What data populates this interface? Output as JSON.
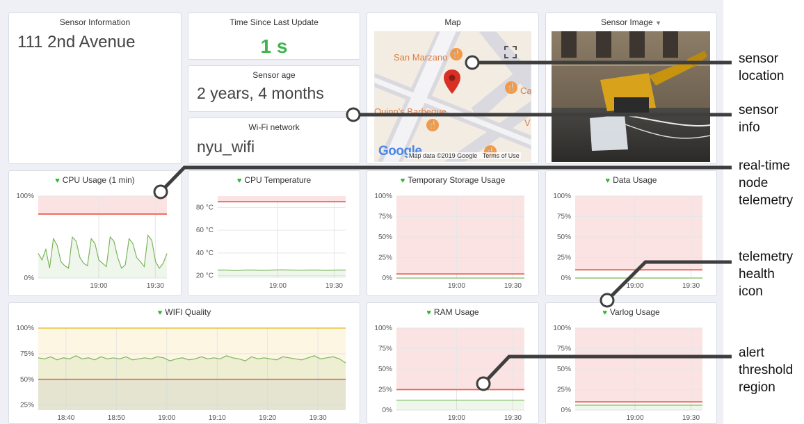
{
  "colors": {
    "heart": "#2eb82e",
    "threshold": "#e8675a",
    "threshold_fill": "#fbe3e3",
    "warning": "#e9c13a",
    "series": "#7cb45c",
    "value_green": "#3ab54a"
  },
  "panels": {
    "sensor_info": {
      "title": "Sensor Information",
      "value": "111 2nd Avenue"
    },
    "time_since": {
      "title": "Time Since Last Update",
      "value": "1 s"
    },
    "sensor_age": {
      "title": "Sensor age",
      "value": "2 years, 4 months"
    },
    "wifi_network": {
      "title": "Wi-Fi network",
      "value": "nyu_wifi"
    },
    "map": {
      "title": "Map",
      "labels": [
        "San Marzano",
        "Quinn's Barbeque",
        "Ca",
        "V"
      ],
      "attribution": "Map data ©2019 Google",
      "terms": "Terms of Use",
      "logo": "Google"
    },
    "sensor_image": {
      "title": "Sensor Image",
      "menu_icon": "caret-down-icon"
    }
  },
  "annotations": {
    "sensor_location": [
      "sensor",
      "location"
    ],
    "sensor_info": [
      "sensor",
      "info"
    ],
    "realtime": [
      "real-time",
      "node",
      "telemetry"
    ],
    "health": [
      "telemetry",
      "health",
      "icon"
    ],
    "alert": [
      "alert",
      "threshold",
      "region"
    ]
  },
  "chart_data": [
    {
      "id": "cpu_usage",
      "type": "line",
      "title": "CPU Usage (1 min)",
      "x_ticks": [
        "19:00",
        "19:30"
      ],
      "y_ticks": [
        "0%",
        "100%"
      ],
      "ylim": [
        0,
        100
      ],
      "threshold": 78,
      "series": [
        {
          "values": [
            30,
            22,
            35,
            12,
            48,
            40,
            20,
            15,
            12,
            50,
            45,
            25,
            18,
            15,
            48,
            42,
            22,
            18,
            14,
            50,
            45,
            25,
            12,
            16,
            48,
            42,
            25,
            20,
            14,
            52,
            46,
            20,
            12,
            18,
            30
          ]
        }
      ]
    },
    {
      "id": "cpu_temp",
      "type": "line",
      "title": "CPU Temperature",
      "x_ticks": [
        "19:00",
        "19:30"
      ],
      "y_ticks": [
        "20 °C",
        "40 °C",
        "60 °C",
        "80 °C"
      ],
      "ylim": [
        18,
        90
      ],
      "threshold": 85,
      "series": [
        {
          "values": [
            25,
            25,
            24.5,
            25,
            25,
            24.8,
            25,
            25.2,
            25,
            24.9,
            25,
            25,
            24.8,
            25,
            25
          ]
        }
      ]
    },
    {
      "id": "temp_storage",
      "type": "line",
      "title": "Temporary Storage Usage",
      "x_ticks": [
        "19:00",
        "19:30"
      ],
      "y_ticks": [
        "0%",
        "25%",
        "50%",
        "75%",
        "100%"
      ],
      "ylim": [
        0,
        100
      ],
      "threshold": 5,
      "series": [
        {
          "values": [
            0,
            0,
            0,
            0,
            0,
            0
          ]
        }
      ]
    },
    {
      "id": "data_usage",
      "type": "line",
      "title": "Data Usage",
      "x_ticks": [
        "19:00",
        "19:30"
      ],
      "y_ticks": [
        "0%",
        "25%",
        "50%",
        "75%",
        "100%"
      ],
      "ylim": [
        0,
        100
      ],
      "threshold": 10,
      "series": [
        {
          "values": [
            0,
            0,
            0,
            0,
            0,
            0
          ]
        }
      ]
    },
    {
      "id": "wifi_quality",
      "type": "line",
      "title": "WIFI Quality",
      "x_ticks": [
        "18:40",
        "18:50",
        "19:00",
        "19:10",
        "19:20",
        "19:30"
      ],
      "y_ticks": [
        "25%",
        "50%",
        "75%",
        "100%"
      ],
      "ylim": [
        20,
        100
      ],
      "threshold": 50,
      "warning": 100,
      "series": [
        {
          "values": [
            71,
            70,
            72,
            69,
            71,
            70,
            73,
            70,
            71,
            69,
            72,
            70,
            71,
            70,
            72,
            69,
            70,
            71,
            70,
            72,
            71,
            68,
            70,
            71,
            69,
            70,
            72,
            70,
            71,
            70,
            73,
            71,
            70,
            68,
            72,
            70,
            71,
            70,
            69,
            72,
            71,
            70,
            69,
            71,
            73,
            70,
            71,
            72,
            70,
            66
          ]
        }
      ]
    },
    {
      "id": "ram_usage",
      "type": "line",
      "title": "RAM Usage",
      "x_ticks": [
        "19:00",
        "19:30"
      ],
      "y_ticks": [
        "0%",
        "25%",
        "50%",
        "75%",
        "100%"
      ],
      "ylim": [
        0,
        100
      ],
      "threshold": 25,
      "series": [
        {
          "values": [
            12,
            12,
            12,
            12,
            12,
            12
          ]
        }
      ]
    },
    {
      "id": "varlog_usage",
      "type": "line",
      "title": "Varlog Usage",
      "x_ticks": [
        "19:00",
        "19:30"
      ],
      "y_ticks": [
        "0%",
        "25%",
        "50%",
        "75%",
        "100%"
      ],
      "ylim": [
        0,
        100
      ],
      "threshold": 10,
      "series": [
        {
          "values": [
            6,
            6,
            6,
            6,
            6,
            6
          ]
        }
      ]
    }
  ]
}
